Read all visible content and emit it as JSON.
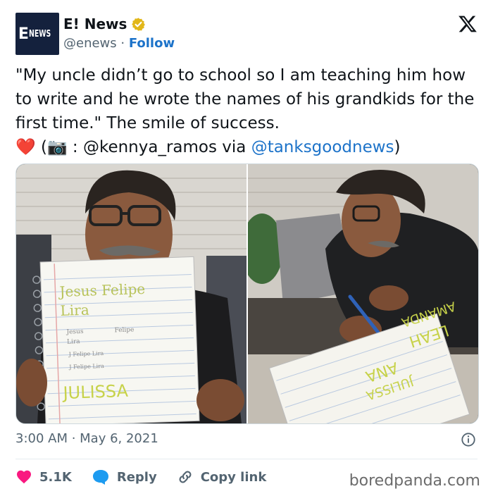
{
  "account": {
    "logo_letter": "E",
    "logo_text": "NEWS",
    "display_name": "E! News",
    "handle": "@enews",
    "separator": " · ",
    "follow_label": "Follow"
  },
  "tweet": {
    "text_main": "\"My uncle didn’t go to school so I am teaching him how to write and he wrote the names of his grandkids for the first time.\" The smile of success.",
    "heart_emoji": "❤️",
    "open_paren": " (",
    "camera_emoji": "📷",
    "credit_middle": " : @kennya_ramos via ",
    "credit_link": "@tanksgoodnews",
    "close_paren": ")"
  },
  "photos": {
    "left_notebook": {
      "line1": "Jesus Felipe",
      "line2": "Lira",
      "line3a": "Jesus",
      "line3b": "Felipe",
      "line4": "Lira",
      "line5": "J Felipe Lira",
      "line6": "J Felipe Lira",
      "line7": "JULISSA"
    },
    "right_notebook": {
      "line1": "JULISSA",
      "line2": "ANA",
      "line3": "LEAH",
      "line4": "AMANDA"
    }
  },
  "meta": {
    "timestamp": "3:00 AM · May 6, 2021"
  },
  "actions": {
    "likes": "5.1K",
    "reply_label": "Reply",
    "copy_label": "Copy link"
  },
  "watermark": "boredpanda.com",
  "colors": {
    "accent_link": "#1d73c9",
    "heart": "#f91880",
    "verified_gold": "#e2b719",
    "reply_blue": "#1d9bf0"
  }
}
